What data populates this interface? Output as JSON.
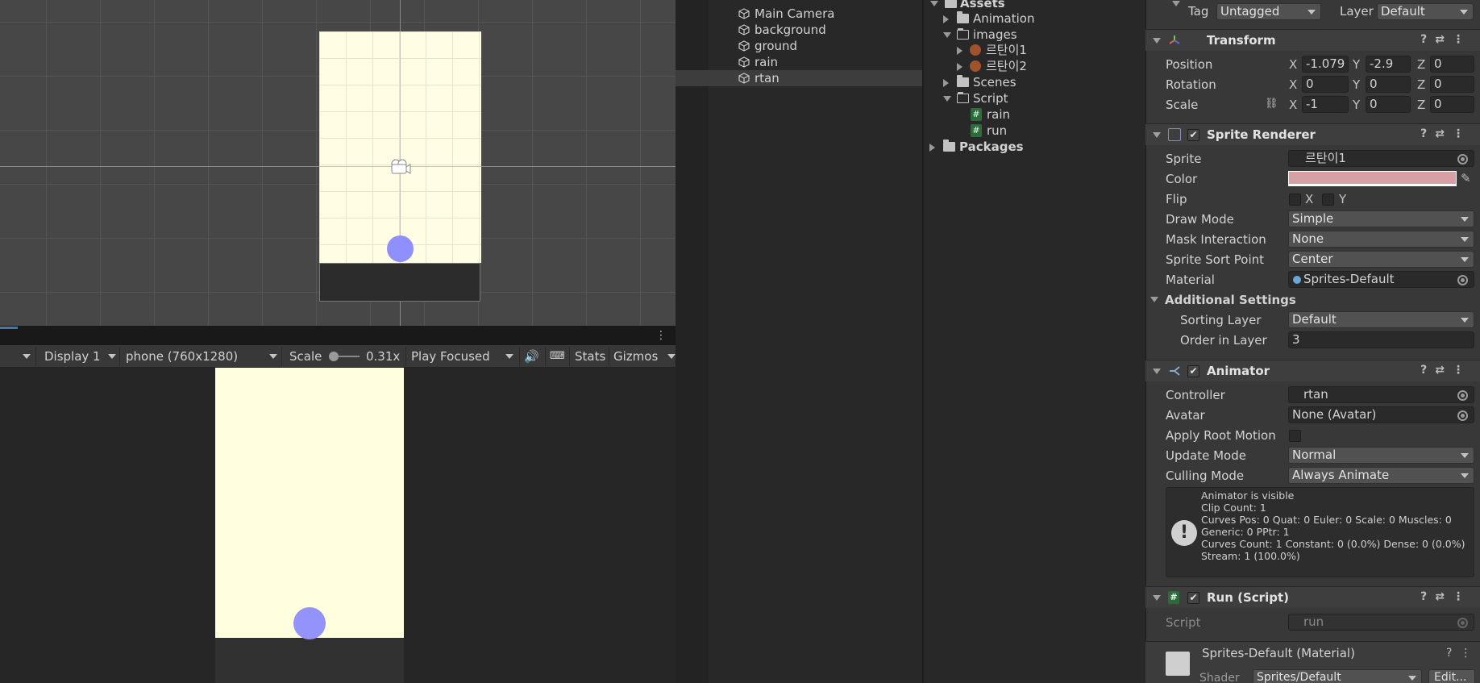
{
  "scene": {
    "ground_color": "#2c2c2c",
    "camera_bg": "#fffde3",
    "ball_color": "#8f8ffd"
  },
  "game_toolbar": {
    "display": "Display 1",
    "resolution": "phone (760x1280)",
    "scale_label": "Scale",
    "scale_value": "0.31x",
    "play_mode": "Play Focused",
    "stats": "Stats",
    "gizmos": "Gizmos"
  },
  "hierarchy": {
    "items": [
      {
        "label": "Main Camera",
        "icon": "cube-icon"
      },
      {
        "label": "background",
        "icon": "cube-icon"
      },
      {
        "label": "ground",
        "icon": "cube-icon"
      },
      {
        "label": "rain",
        "icon": "cube-icon"
      },
      {
        "label": "rtan",
        "icon": "cube-icon",
        "selected": true
      }
    ]
  },
  "project": {
    "root": "Assets",
    "items": [
      {
        "label": "Animation"
      },
      {
        "label": "images"
      },
      {
        "label": "르탄이1"
      },
      {
        "label": "르탄이2"
      },
      {
        "label": "Scenes"
      },
      {
        "label": "Script"
      },
      {
        "label": "rain"
      },
      {
        "label": "run"
      },
      {
        "label": "Packages"
      }
    ]
  },
  "inspector": {
    "tag_label": "Tag",
    "tag_value": "Untagged",
    "layer_label": "Layer",
    "layer_value": "Default",
    "transform": {
      "title": "Transform",
      "position_label": "Position",
      "position": [
        "-1.079",
        "-2.9",
        "0"
      ],
      "rotation_label": "Rotation",
      "rotation": [
        "0",
        "0",
        "0"
      ],
      "scale_label": "Scale",
      "scale": [
        "-1",
        "0",
        "0"
      ],
      "x": "X",
      "y": "Y",
      "z": "Z"
    },
    "sprite_renderer": {
      "title": "Sprite Renderer",
      "sprite_label": "Sprite",
      "sprite_value": "르탄이1",
      "color_label": "Color",
      "color_value": "#d6a0a4",
      "flip_label": "Flip",
      "flip_x": "X",
      "flip_y": "Y",
      "draw_mode_label": "Draw Mode",
      "draw_mode": "Simple",
      "mask_label": "Mask Interaction",
      "mask": "None",
      "sort_point_label": "Sprite Sort Point",
      "sort_point": "Center",
      "material_label": "Material",
      "material": "Sprites-Default",
      "additional_label": "Additional Settings",
      "sorting_layer_label": "Sorting Layer",
      "sorting_layer": "Default",
      "order_label": "Order in Layer",
      "order": "3"
    },
    "animator": {
      "title": "Animator",
      "controller_label": "Controller",
      "controller": "rtan",
      "avatar_label": "Avatar",
      "avatar": "None (Avatar)",
      "root_motion_label": "Apply Root Motion",
      "update_label": "Update Mode",
      "update": "Normal",
      "culling_label": "Culling Mode",
      "culling": "Always Animate",
      "info": [
        "Animator is visible",
        "Clip Count: 1",
        "Curves Pos: 0 Quat: 0 Euler: 0 Scale: 0 Muscles: 0",
        "Generic: 0 PPtr: 1",
        "Curves Count: 1 Constant: 0 (0.0%) Dense: 0 (0.0%)",
        "Stream: 1 (100.0%)"
      ]
    },
    "run_script": {
      "title": "Run (Script)",
      "script_label": "Script",
      "script": "run"
    },
    "material": {
      "title": "Sprites-Default (Material)",
      "shader_label": "Shader",
      "shader": "Sprites/Default",
      "edit": "Edit..."
    }
  }
}
